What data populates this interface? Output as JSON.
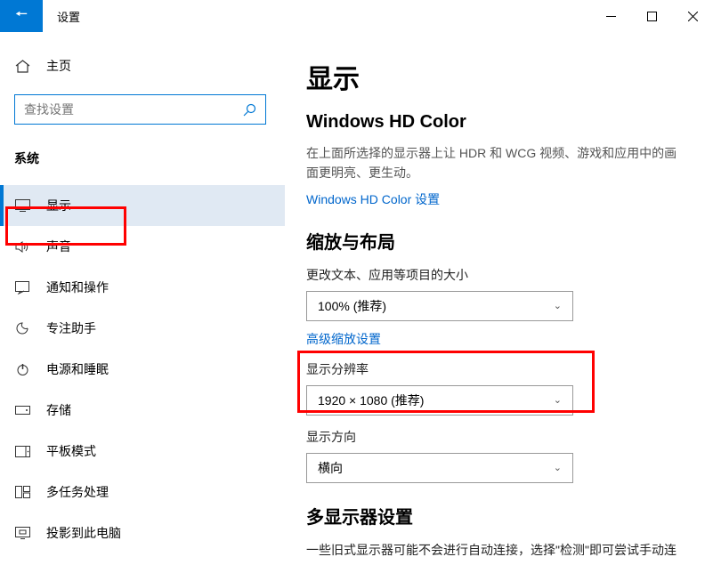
{
  "titlebar": {
    "title": "设置"
  },
  "sidebar": {
    "home": "主页",
    "search_placeholder": "查找设置",
    "category": "系统",
    "items": [
      {
        "label": "显示"
      },
      {
        "label": "声音"
      },
      {
        "label": "通知和操作"
      },
      {
        "label": "专注助手"
      },
      {
        "label": "电源和睡眠"
      },
      {
        "label": "存储"
      },
      {
        "label": "平板模式"
      },
      {
        "label": "多任务处理"
      },
      {
        "label": "投影到此电脑"
      }
    ]
  },
  "main": {
    "title": "显示",
    "hd_color": {
      "heading": "Windows HD Color",
      "desc": "在上面所选择的显示器上让 HDR 和 WCG 视频、游戏和应用中的画面更明亮、更生动。",
      "link": "Windows HD Color 设置"
    },
    "scale": {
      "heading": "缩放与布局",
      "text_size_label": "更改文本、应用等项目的大小",
      "text_size_value": "100% (推荐)",
      "advanced_link": "高级缩放设置",
      "resolution_label": "显示分辨率",
      "resolution_value": "1920 × 1080 (推荐)",
      "orientation_label": "显示方向",
      "orientation_value": "横向"
    },
    "multi": {
      "heading": "多显示器设置",
      "desc": "一些旧式显示器可能不会进行自动连接，选择\"检测\"即可尝试手动连"
    }
  }
}
